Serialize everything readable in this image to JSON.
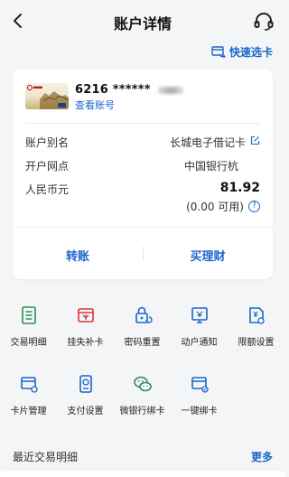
{
  "header": {
    "title": "账户详情"
  },
  "quick_select": {
    "label": "快速选卡"
  },
  "account": {
    "card_number": "6216 ****** ",
    "view_account_label": "查看账号",
    "alias_label": "账户别名",
    "alias_value": "长城电子借记卡",
    "branch_label": "开户网点",
    "branch_value": "中国银行杭",
    "currency_label": "人民币元",
    "balance": "81.92",
    "available": "(0.00 可用)"
  },
  "actions": {
    "transfer": "转账",
    "wealth": "买理财"
  },
  "functions": [
    {
      "label": "交易明细",
      "icon": "list-icon"
    },
    {
      "label": "挂失补卡",
      "icon": "report-loss-icon"
    },
    {
      "label": "密码重置",
      "icon": "password-reset-icon"
    },
    {
      "label": "动户通知",
      "icon": "notification-icon"
    },
    {
      "label": "限额设置",
      "icon": "limit-settings-icon"
    },
    {
      "label": "卡片管理",
      "icon": "card-manage-icon"
    },
    {
      "label": "支付设置",
      "icon": "payment-settings-icon"
    },
    {
      "label": "微银行绑卡",
      "icon": "wechat-bind-icon"
    },
    {
      "label": "一键绑卡",
      "icon": "one-click-bind-icon"
    }
  ],
  "recent": {
    "title": "最近交易明细",
    "more": "更多"
  },
  "colors": {
    "accent": "#1a66c9",
    "icon_green": "#2e8b57",
    "icon_red": "#d9363e"
  }
}
